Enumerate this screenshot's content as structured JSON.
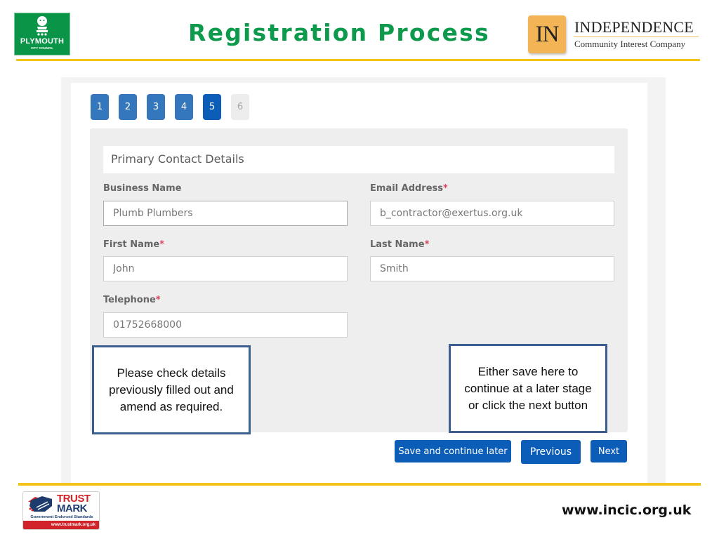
{
  "slide": {
    "title": "Registration Process",
    "footer_url": "www.incic.org.uk",
    "accent_colors": {
      "title_green": "#0e9a4c",
      "rule_gold": "#f4c319",
      "button_blue": "#0b5db7",
      "note_border": "#3b5f8f"
    }
  },
  "logos": {
    "plymouth": {
      "name": "PLYMOUTH",
      "sub": "CITY COUNCIL",
      "icon": "lion-crest-icon"
    },
    "independence": {
      "mark": "IN",
      "name": "INDEPENDENCE",
      "sub": "Community Interest Company"
    },
    "trustmark": {
      "line1": "TRUST",
      "line2": "MARK",
      "tagline": "Government Endorsed Standards",
      "url": "www.trustmark.org.uk",
      "icon": "handshake-icon"
    }
  },
  "app": {
    "steps": [
      {
        "label": "1",
        "state": "complete"
      },
      {
        "label": "2",
        "state": "complete"
      },
      {
        "label": "3",
        "state": "complete"
      },
      {
        "label": "4",
        "state": "complete"
      },
      {
        "label": "5",
        "state": "active"
      },
      {
        "label": "6",
        "state": "disabled"
      }
    ],
    "section_title": "Primary Contact Details",
    "fields": {
      "business_name": {
        "label": "Business Name",
        "required": false,
        "value": "Plumb Plumbers"
      },
      "email": {
        "label": "Email Address",
        "required": true,
        "value": "b_contractor@exertus.org.uk"
      },
      "first_name": {
        "label": "First Name",
        "required": true,
        "value": "John"
      },
      "last_name": {
        "label": "Last Name",
        "required": true,
        "value": "Smith"
      },
      "telephone": {
        "label": "Telephone",
        "required": true,
        "value": "01752668000"
      }
    },
    "required_marker": "*",
    "buttons": {
      "save_later": "Save and continue later",
      "previous": "Previous",
      "next": "Next"
    }
  },
  "callouts": {
    "left": "Please check details previously filled out and amend as required.",
    "right": "Either save here to continue at a later stage or click the next button"
  }
}
